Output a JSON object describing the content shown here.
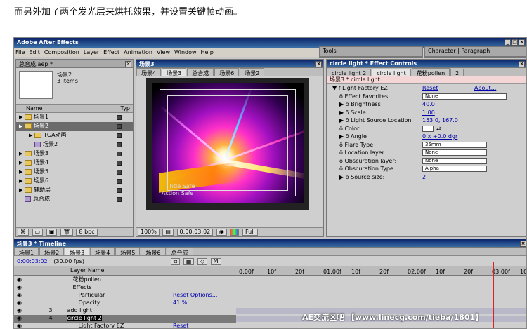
{
  "caption": "而另外加了两个发光层来烘托效果，并设置关键帧动画。",
  "app": {
    "title": "Adobe After Effects",
    "menu": [
      "File",
      "Edit",
      "Composition",
      "Layer",
      "Effect",
      "Animation",
      "View",
      "Window",
      "Help"
    ]
  },
  "project": {
    "title": "总合成.aep *",
    "selected_name": "场景2",
    "selected_info": "3 items",
    "col_name": "Name",
    "col_type": "Typ",
    "items": [
      {
        "label": "场景1",
        "kind": "folder",
        "indent": 0
      },
      {
        "label": "场景2",
        "kind": "folder",
        "indent": 0,
        "selected": true
      },
      {
        "label": "TGA动画",
        "kind": "folder",
        "indent": 1
      },
      {
        "label": "场景2",
        "kind": "comp",
        "indent": 1
      },
      {
        "label": "场景3",
        "kind": "folder",
        "indent": 0
      },
      {
        "label": "场景4",
        "kind": "folder",
        "indent": 0
      },
      {
        "label": "场景5",
        "kind": "folder",
        "indent": 0
      },
      {
        "label": "场景6",
        "kind": "folder",
        "indent": 0
      },
      {
        "label": "辅助层",
        "kind": "folder",
        "indent": 0
      },
      {
        "label": "总合成",
        "kind": "comp",
        "indent": 0
      }
    ],
    "footer_bpc": "8 bpc"
  },
  "comp_window": {
    "title": "场景3",
    "tabs": [
      "场景4",
      "场景3",
      "总合成",
      "场景6",
      "场景2"
    ],
    "active_tab": 1,
    "title_safe": "Title Safe",
    "action_safe": "Action Safe",
    "zoom": "100%",
    "timecode": "0:00:03:02",
    "resolution": "Full"
  },
  "tools_tab": "Tools",
  "char_tabs": [
    "Character",
    "Paragraph"
  ],
  "effect_controls": {
    "title": "circle light * Effect Controls",
    "tabs": [
      "circle light 2",
      "circle light",
      "花粉pollen",
      "2"
    ],
    "active_tab": 1,
    "layer_path": "场景3 * circle light",
    "effect_name": "Light Factory EZ",
    "reset": "Reset",
    "about": "About...",
    "rows": [
      {
        "label": "Effect Favorites",
        "value": "None",
        "type": "dropdown"
      },
      {
        "label": "Brightness",
        "value": "40.0",
        "type": "value"
      },
      {
        "label": "Scale",
        "value": "1.00",
        "type": "value"
      },
      {
        "label": "Light Source Location",
        "value": "153.0, 167.0",
        "type": "value"
      },
      {
        "label": "Color",
        "value": "",
        "type": "color"
      },
      {
        "label": "Angle",
        "value": "0 x +0.0 dgr",
        "type": "value"
      },
      {
        "label": "Flare Type",
        "value": "35mm",
        "type": "dropdown"
      },
      {
        "label": "Location layer:",
        "value": "None",
        "type": "dropdown"
      },
      {
        "label": "Obscuration layer:",
        "value": "None",
        "type": "dropdown"
      },
      {
        "label": "Obscuration Type",
        "value": "Alpha",
        "type": "dropdown"
      },
      {
        "label": "Source size:",
        "value": "2",
        "type": "value"
      }
    ]
  },
  "timeline": {
    "title": "场景3 * Timeline",
    "tabs": [
      "场景1",
      "场景2",
      "场景3",
      "场景4",
      "场景5",
      "场景6",
      "总合成"
    ],
    "active_tab": 2,
    "timecode": "0:00:03:02",
    "fps": "(30.00 fps)",
    "col_layer_name": "Layer Name",
    "ruler": [
      "0:00f",
      "10f",
      "20f",
      "01:00f",
      "10f",
      "20f",
      "02:00f",
      "10f",
      "20f",
      "03:00f",
      "10f"
    ],
    "layers": [
      {
        "num": "",
        "name": "花粉pollen",
        "indent": 2,
        "value": ""
      },
      {
        "num": "",
        "name": "Effects",
        "indent": 2,
        "value": ""
      },
      {
        "num": "",
        "name": "Particular",
        "indent": 3,
        "value": "Reset Options..."
      },
      {
        "num": "",
        "name": "Opacity",
        "indent": 3,
        "value": "41 %"
      },
      {
        "num": "3",
        "name": "add light",
        "indent": 1,
        "value": ""
      },
      {
        "num": "4",
        "name": "circle light 2",
        "indent": 1,
        "value": ""
      },
      {
        "num": "",
        "name": "Light Factory EZ",
        "indent": 3,
        "value": "Reset"
      }
    ]
  },
  "watermark": "AE交流区吧 【www.linecg.com/tieba/1801】"
}
